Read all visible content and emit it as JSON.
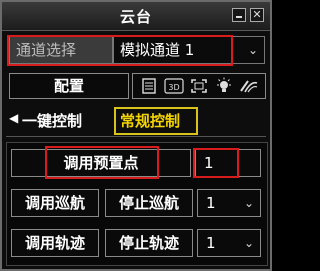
{
  "window": {
    "title": "云台"
  },
  "channel": {
    "label": "通道选择",
    "value": "模拟通道 1"
  },
  "toolbar": {
    "config_label": "配置",
    "icons": [
      "list-icon",
      "3d-icon",
      "fullscreen-icon",
      "light-icon",
      "wiper-icon"
    ],
    "icon_3d_text": "3D"
  },
  "tabs": {
    "quick": "一键控制",
    "normal": "常规控制",
    "active": "常规控制"
  },
  "controls": {
    "call_preset": "调用预置点",
    "preset_value": "1",
    "call_cruise": "调用巡航",
    "stop_cruise": "停止巡航",
    "cruise_value": "1",
    "call_track": "调用轨迹",
    "stop_track": "停止轨迹",
    "track_value": "1"
  },
  "colors": {
    "highlight_red": "#d81c1c",
    "active_tab": "#f4d400"
  }
}
